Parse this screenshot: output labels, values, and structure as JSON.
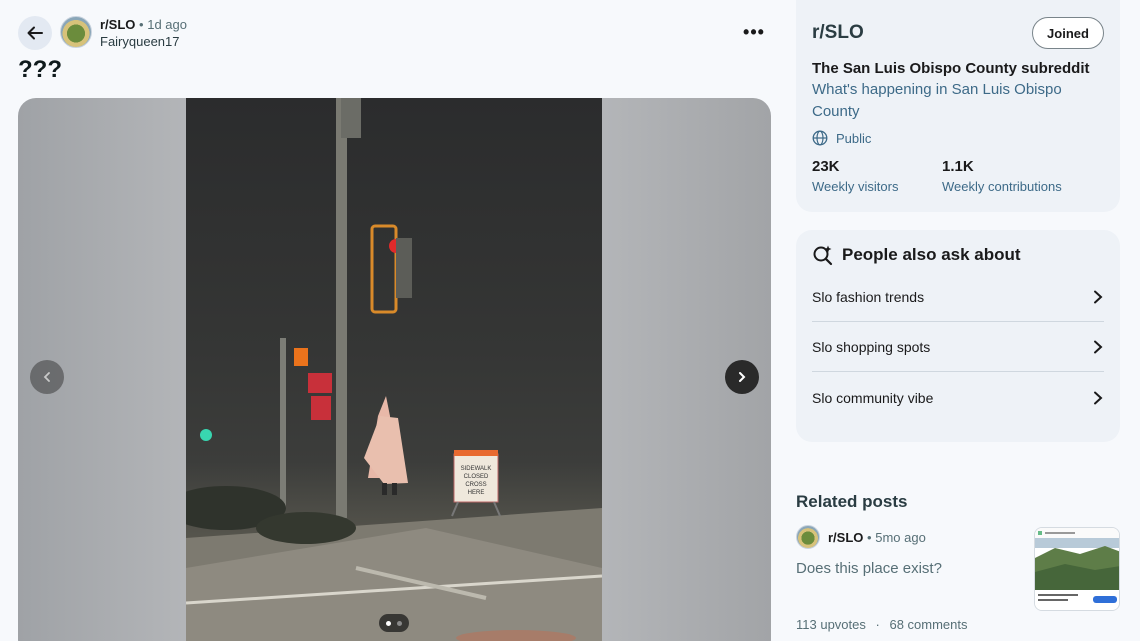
{
  "post": {
    "subreddit": "r/SLO",
    "separator": "•",
    "age": "1d ago",
    "author": "Fairyqueen17",
    "title": "???",
    "more": "•••"
  },
  "media": {
    "prev_icon": "chevron-left-icon",
    "next_icon": "chevron-right-icon",
    "sign_text": [
      "SIDEWALK",
      "CLOSED",
      "CROSS",
      "HERE"
    ],
    "current_slide": 1,
    "total_slides": 2
  },
  "sidebar": {
    "community": {
      "name": "r/SLO",
      "join_label": "Joined",
      "headline": "The San Luis Obispo County subreddit",
      "description": "What's happening in San Luis Obispo County",
      "visibility": "Public",
      "stats": [
        {
          "value": "23K",
          "label": "Weekly visitors"
        },
        {
          "value": "1.1K",
          "label": "Weekly contributions"
        }
      ]
    },
    "people_also_ask": {
      "title": "People also ask about",
      "items": [
        {
          "label": "Slo fashion trends"
        },
        {
          "label": "Slo shopping spots"
        },
        {
          "label": "Slo community vibe"
        }
      ]
    },
    "related": {
      "title": "Related posts",
      "post": {
        "subreddit": "r/SLO",
        "separator": "•",
        "age": "5mo ago",
        "title": "Does this place exist?",
        "upvotes": "113 upvotes",
        "stat_sep": "·",
        "comments": "68 comments"
      }
    }
  },
  "colors": {
    "page_bg": "#f7f9fc",
    "card_bg": "#eef2f7",
    "link_blue": "#3d6a88",
    "muted": "#576f76"
  }
}
